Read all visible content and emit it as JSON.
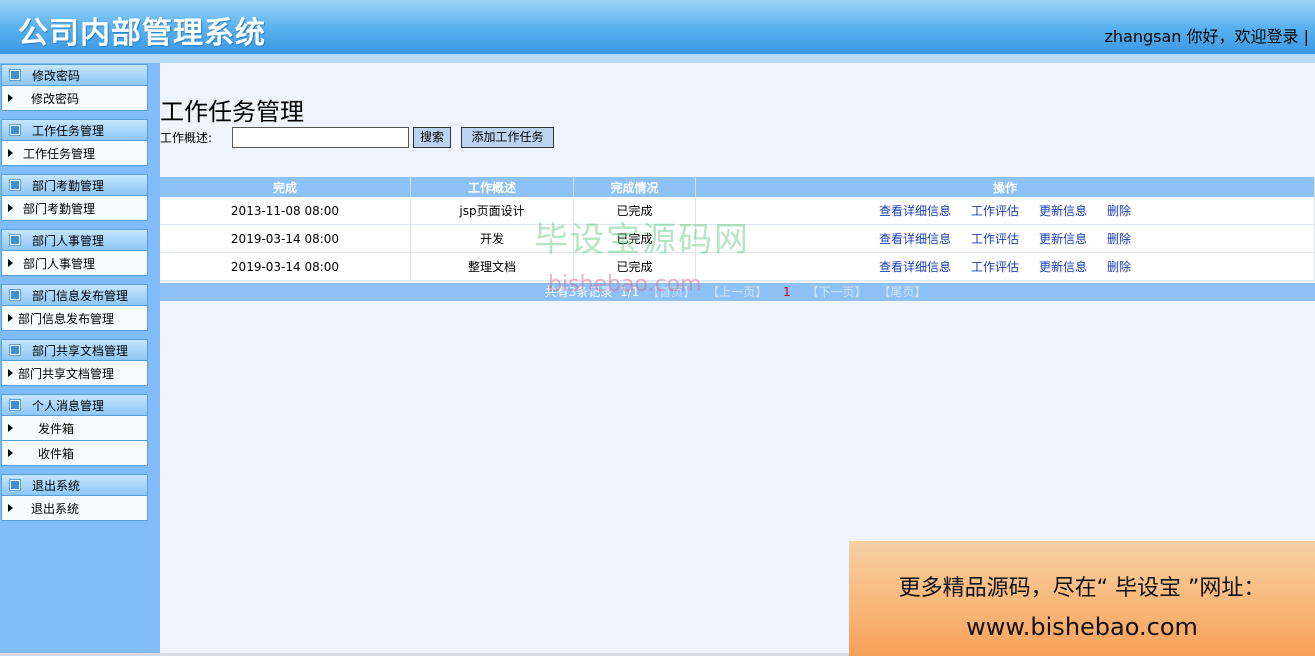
{
  "header": {
    "title": "公司内部管理系统",
    "greeting": "zhangsan 你好，欢迎登录 |"
  },
  "sidebar": {
    "groups": [
      {
        "title": "修改密码",
        "items": [
          "修改密码"
        ]
      },
      {
        "title": "工作任务管理",
        "items": [
          "工作任务管理"
        ]
      },
      {
        "title": "部门考勤管理",
        "items": [
          "部门考勤管理"
        ]
      },
      {
        "title": "部门人事管理",
        "items": [
          "部门人事管理"
        ]
      },
      {
        "title": "部门信息发布管理",
        "items": [
          "部门信息发布管理"
        ]
      },
      {
        "title": "部门共享文档管理",
        "items": [
          "部门共享文档管理"
        ]
      },
      {
        "title": "个人消息管理",
        "items": [
          "发件箱",
          "收件箱"
        ]
      },
      {
        "title": "退出系统",
        "items": [
          "退出系统"
        ]
      }
    ]
  },
  "main": {
    "page_title": "工作任务管理",
    "search": {
      "label": "工作概述:",
      "value": "",
      "button": "搜索"
    },
    "add_button": "添加工作任务",
    "table": {
      "columns": [
        "完成",
        "工作概述",
        "完成情况",
        "操作"
      ],
      "rows": [
        {
          "time": "2013-11-08 08:00",
          "summary": "jsp页面设计",
          "status": "已完成"
        },
        {
          "time": "2019-03-14 08:00",
          "summary": "开发",
          "status": "已完成"
        },
        {
          "time": "2019-03-14 08:00",
          "summary": "整理文档",
          "status": "已完成"
        }
      ],
      "actions": [
        "查看详细信息",
        "工作评估",
        "更新信息",
        "删除"
      ]
    },
    "pager": {
      "summary": "共有3条记录",
      "page": "1/1",
      "first": "首页",
      "prev": "上一页",
      "current": "1",
      "next": "下一页",
      "last": "尾页"
    }
  },
  "watermark": {
    "cn": "毕设宝源码网",
    "en": "bishebao.com"
  },
  "ad": {
    "line1": "更多精品源码，尽在“ 毕设宝 ”网址：",
    "line2": "www.bishebao.com"
  }
}
